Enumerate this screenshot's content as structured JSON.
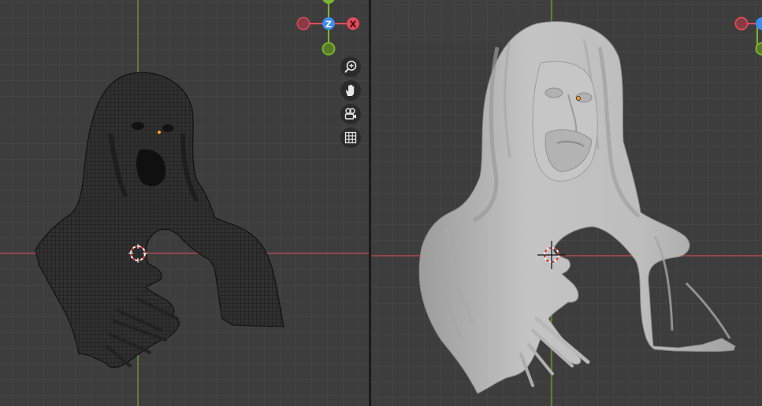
{
  "viewports": {
    "left": {
      "mode": "wireframe"
    },
    "right": {
      "mode": "solid"
    }
  },
  "gizmo": {
    "z_label": "Z",
    "x_label": "X"
  },
  "nav_tools": [
    {
      "name": "zoom-icon",
      "label": "zoom"
    },
    {
      "name": "pan-hand-icon",
      "label": "pan"
    },
    {
      "name": "camera-view-icon",
      "label": "camera"
    },
    {
      "name": "ortho-grid-icon",
      "label": "grid"
    }
  ],
  "colors": {
    "background": "#3d3d3d",
    "grid": "#4a4a4a",
    "x_axis": "#c84a55",
    "y_axis": "#76a82c",
    "gizmo_x": "#e44a5a",
    "gizmo_y": "#7bb32e",
    "gizmo_z": "#3d8df0",
    "origin": "#ff9a2a"
  }
}
